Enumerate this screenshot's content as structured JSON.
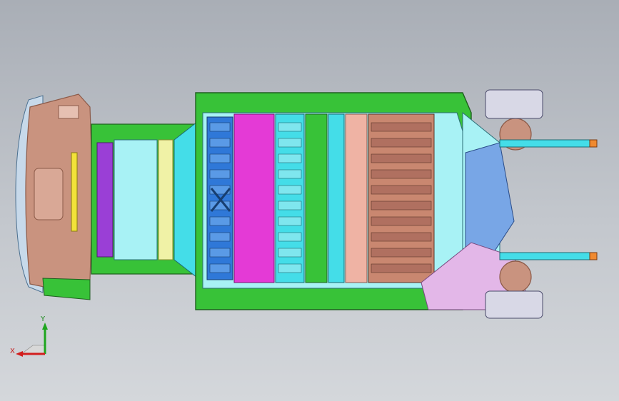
{
  "view": {
    "background_top": "#a9aeb6",
    "background_bottom": "#d4d7db",
    "model": "vehicle-chassis-bottom-view"
  },
  "colors": {
    "frame_green": "#38c238",
    "frame_outline": "#1f5f1f",
    "cyan": "#44dde8",
    "light_cyan": "#a8f2f5",
    "blue": "#2f78d8",
    "magenta": "#e43ad6",
    "purple": "#9a3fd6",
    "yellow_light": "#f0f2a6",
    "yellow": "#f2e23a",
    "salmon": "#efb3a4",
    "brown": "#c98770",
    "pink_lavender": "#e3b7e8",
    "rear_brown": "#c9937f",
    "dark_brown": "#8c5a48"
  },
  "triad": {
    "x_label": "X",
    "y_label": "Y"
  }
}
